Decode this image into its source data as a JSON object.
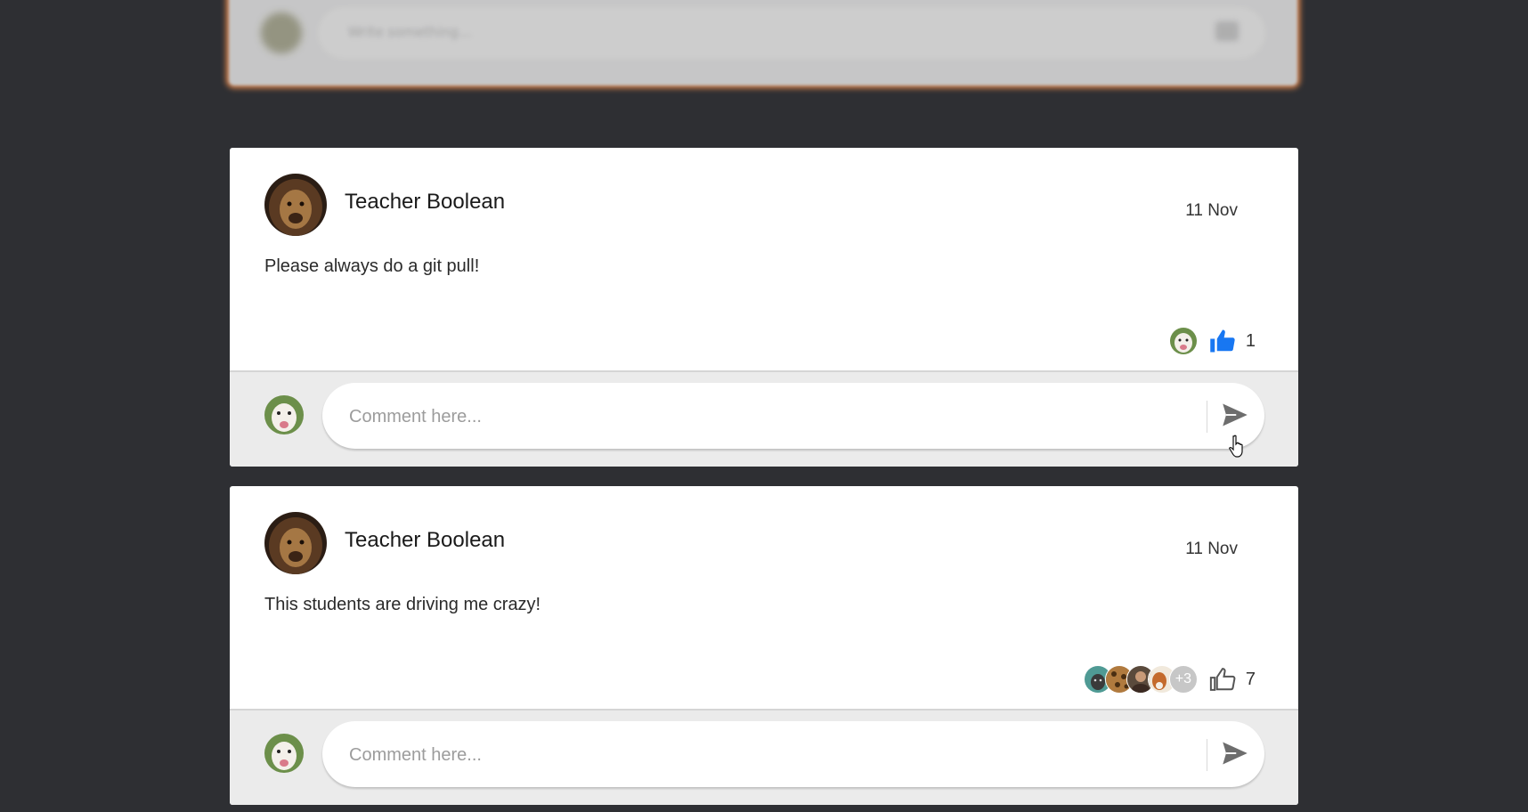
{
  "composer": {
    "placeholder": "Write something..."
  },
  "posts": [
    {
      "author": "Teacher Boolean",
      "date": "11 Nov",
      "text": "Please always do a git pull!",
      "like_count": "1",
      "liked": true,
      "reactor_extra": "",
      "comment_placeholder": "Comment here..."
    },
    {
      "author": "Teacher Boolean",
      "date": "11 Nov",
      "text": "This students are driving me crazy!",
      "like_count": "7",
      "liked": false,
      "reactor_extra": "+3",
      "comment_placeholder": "Comment here..."
    }
  ],
  "icons": {
    "like": "thumbs-up-icon",
    "send": "send-icon"
  },
  "colors": {
    "background": "#2e2f33",
    "like_active": "#1877f2",
    "composer_glow": "#e98b4e"
  }
}
